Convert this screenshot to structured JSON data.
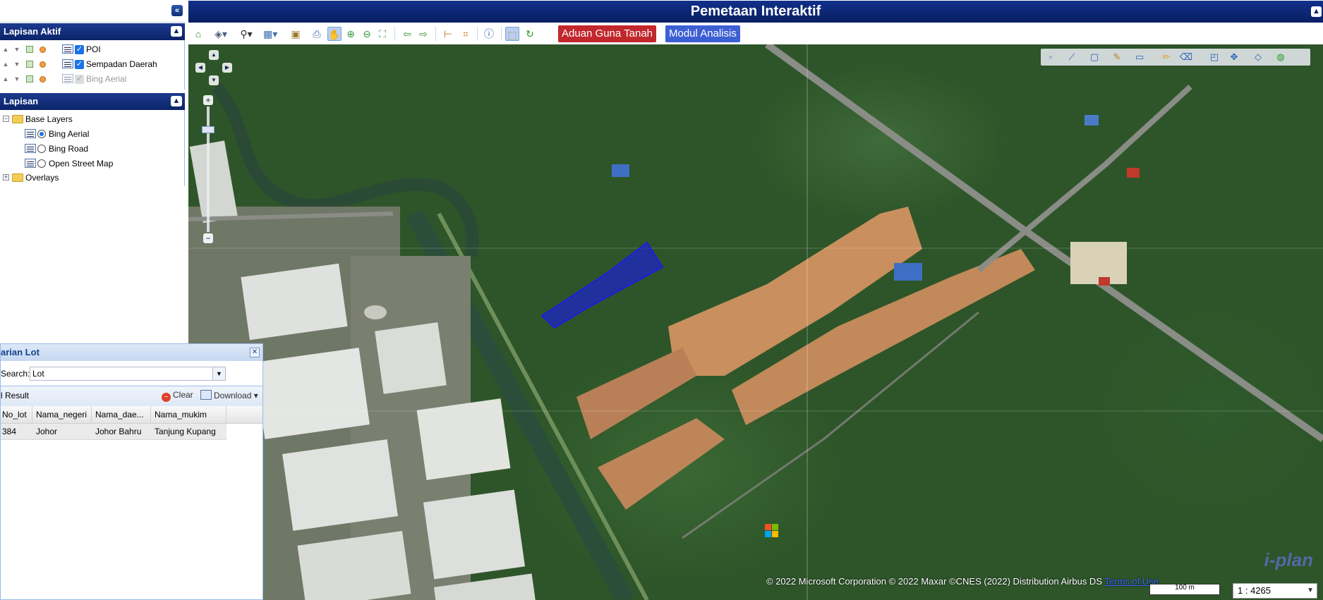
{
  "header": {
    "title": "Pemetaan Interaktif"
  },
  "active_layers": {
    "title": "Lapisan Aktif",
    "items": [
      {
        "label": "POI",
        "checked": true
      },
      {
        "label": "Sempadan Daerah",
        "checked": true
      },
      {
        "label": "Bing Aerial",
        "checked": true,
        "disabled": true
      }
    ]
  },
  "layers": {
    "title": "Lapisan",
    "base_folder": "Base Layers",
    "base_items": [
      {
        "label": "Bing Aerial",
        "selected": true
      },
      {
        "label": "Bing Road",
        "selected": false
      },
      {
        "label": "Open Street Map",
        "selected": false
      }
    ],
    "overlays_folder": "Overlays"
  },
  "toolbar": {
    "complaint_button": "Aduan Guna Tanah",
    "analysis_button": "Modul Analisis"
  },
  "search_window": {
    "title": "arian Lot",
    "search_label": "Search:",
    "search_value": "Lot",
    "result_label": "l Result",
    "clear_label": "Clear",
    "download_label": "Download",
    "columns": [
      "No_lot",
      "Nama_negeri",
      "Nama_dae...",
      "Nama_mukim"
    ],
    "rows": [
      [
        "384",
        "Johor",
        "Johor Bahru",
        "Tanjung Kupang"
      ]
    ]
  },
  "map": {
    "copyright": "© 2022 Microsoft Corporation © 2022 Maxar ©CNES (2022) Distribution Airbus DS",
    "terms_link": "Terms of Use",
    "scale_bar": "100 m",
    "scale_value": "1 : 4265",
    "watermark": "i-plan"
  },
  "colors": {
    "header_bg": "#0a1f63",
    "panel_head": "#0b2469",
    "complaint_btn": "#c1272d",
    "analysis_btn": "#3d5fd4",
    "lot_polygon": "#1a1fdc"
  }
}
